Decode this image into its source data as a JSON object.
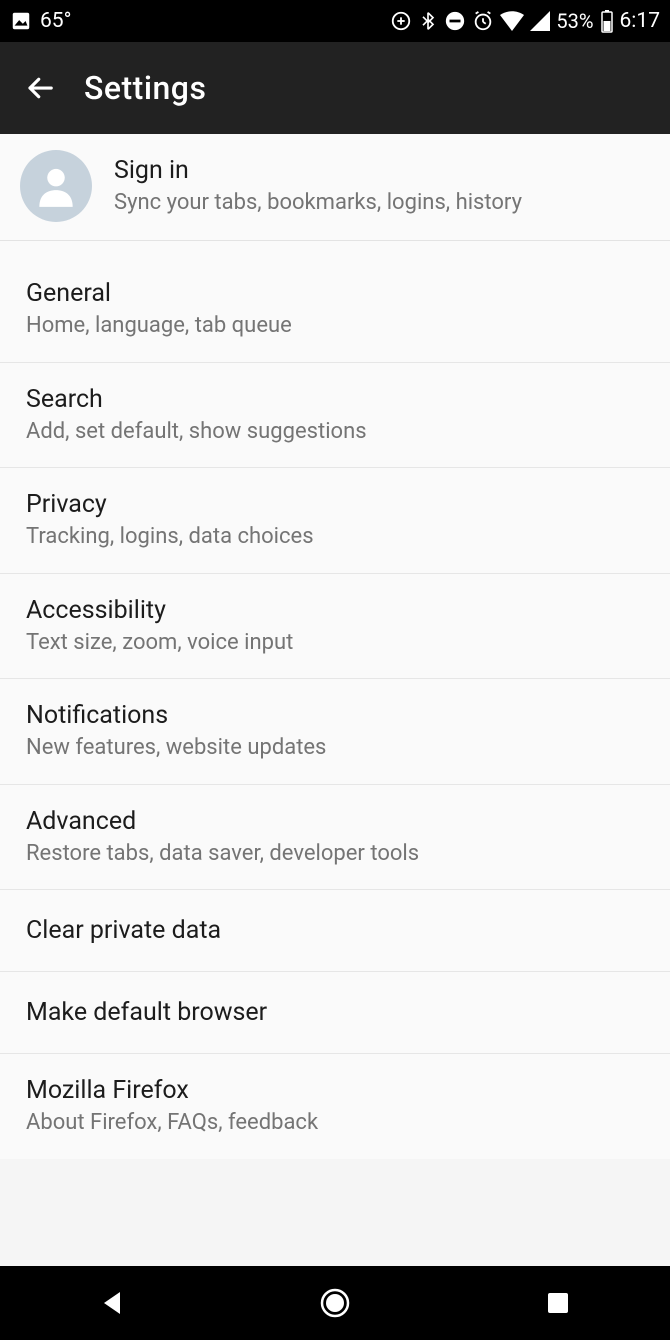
{
  "status": {
    "temp": "65°",
    "battery_pct": "53%",
    "time": "6:17"
  },
  "header": {
    "title": "Settings"
  },
  "signin": {
    "title": "Sign in",
    "subtitle": "Sync your tabs, bookmarks, logins, history"
  },
  "rows": [
    {
      "title": "General",
      "subtitle": "Home, language, tab queue"
    },
    {
      "title": "Search",
      "subtitle": "Add, set default, show suggestions"
    },
    {
      "title": "Privacy",
      "subtitle": "Tracking, logins, data choices"
    },
    {
      "title": "Accessibility",
      "subtitle": "Text size, zoom, voice input"
    },
    {
      "title": "Notifications",
      "subtitle": "New features, website updates"
    },
    {
      "title": "Advanced",
      "subtitle": "Restore tabs, data saver, developer tools"
    },
    {
      "title": "Clear private data",
      "subtitle": ""
    },
    {
      "title": "Make default browser",
      "subtitle": ""
    },
    {
      "title": "Mozilla Firefox",
      "subtitle": "About Firefox, FAQs, feedback"
    }
  ]
}
